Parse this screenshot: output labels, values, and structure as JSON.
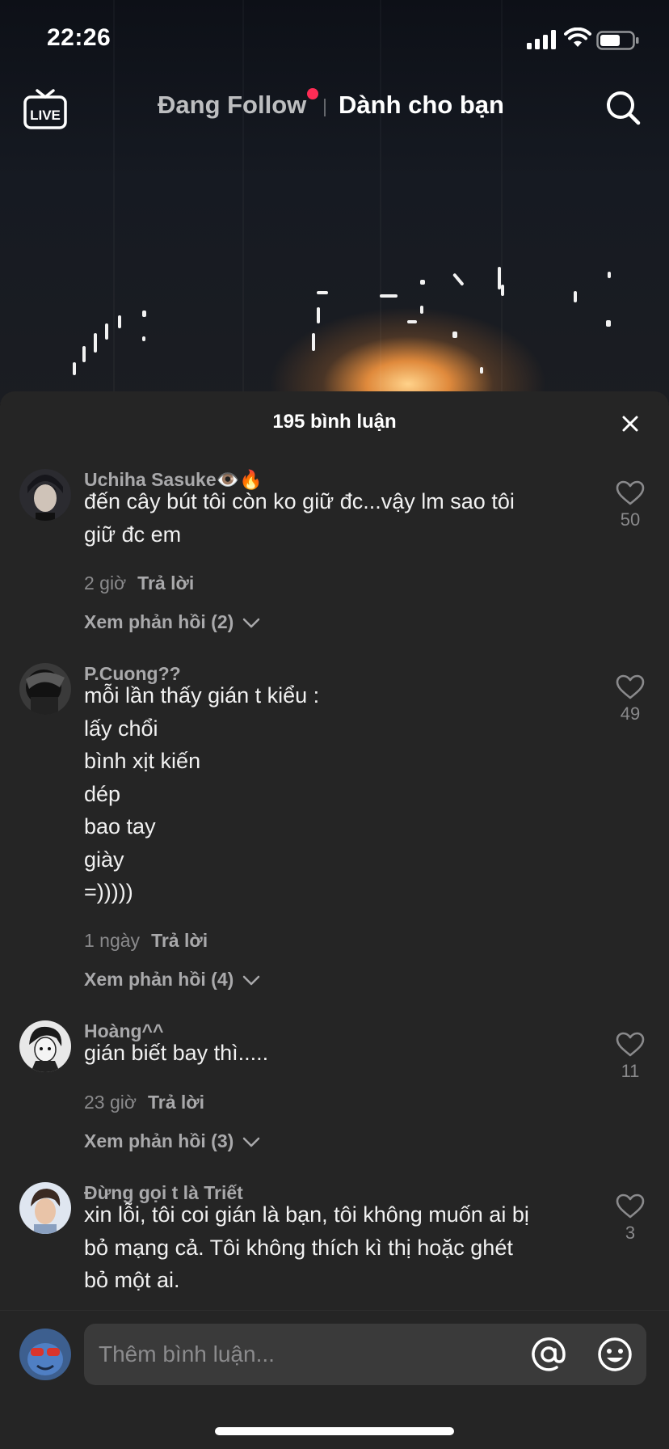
{
  "status_bar": {
    "time": "22:26",
    "signal_icon": "cellular-signal-icon",
    "wifi_icon": "wifi-icon",
    "battery_icon": "battery-icon"
  },
  "top_nav": {
    "live_icon": "live-tv-icon",
    "live_label": "LIVE",
    "tabs": [
      {
        "label": "Đang Follow",
        "has_dot": true,
        "dot_color": "#fe2c55"
      },
      {
        "label": "Dành cho bạn",
        "active": true
      }
    ],
    "search_icon": "search-icon"
  },
  "comments_sheet": {
    "title": "195 bình luận",
    "close_icon": "close-icon",
    "comments": [
      {
        "username": "Uchiha Sasuke👁️🔥",
        "lines": [
          "đến cây bút tôi còn ko giữ đc...vậy lm sao tôi",
          "giữ đc em"
        ],
        "time": "2 giờ",
        "reply_label": "Trả lời",
        "view_replies": "Xem phản hồi (2)",
        "likes": "50"
      },
      {
        "username": "P.Cuong??",
        "lines": [
          "mỗi lần thấy gián t kiểu :",
          "lấy chổi",
          "bình xịt kiến",
          "dép",
          "bao tay",
          "giày",
          "=)))))"
        ],
        "time": "1 ngày",
        "reply_label": "Trả lời",
        "view_replies": "Xem phản hồi (4)",
        "likes": "49"
      },
      {
        "username": "Hoàng^^",
        "lines": [
          "gián biết bay thì....."
        ],
        "time": "23 giờ",
        "reply_label": "Trả lời",
        "view_replies": "Xem phản hồi (3)",
        "likes": "11"
      },
      {
        "username": "Đừng gọi t là Triết",
        "lines": [
          "xin lỗi, tôi coi gián là bạn, tôi không muốn ai bị",
          "bỏ mạng cả. Tôi không thích kì thị hoặc ghét",
          "bỏ một ai."
        ],
        "likes": "3"
      }
    ]
  },
  "composer": {
    "placeholder": "Thêm bình luận...",
    "mention_icon": "at-mention-icon",
    "emoji_icon": "emoji-icon"
  },
  "colors": {
    "accent": "#fe2c55",
    "sheet_bg": "#252525",
    "input_bg": "#3a3a3a"
  }
}
